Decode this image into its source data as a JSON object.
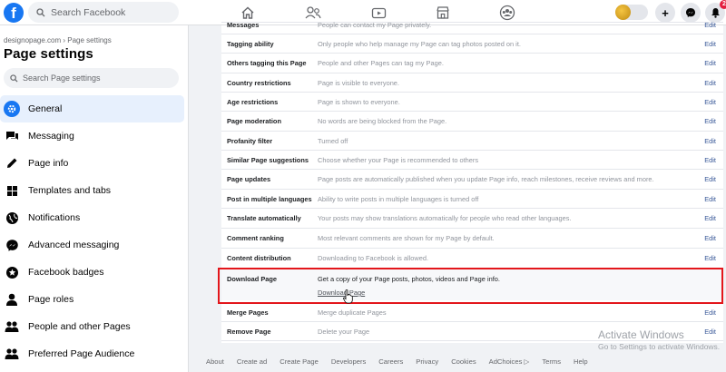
{
  "topbar": {
    "logo": "f",
    "search_placeholder": "Search Facebook",
    "notification_count": "2",
    "icons": [
      "home-icon",
      "friends-icon",
      "watch-icon",
      "marketplace-icon",
      "groups-icon"
    ]
  },
  "sidebar": {
    "breadcrumb": "designopage.com › Page settings",
    "title": "Page settings",
    "search_placeholder": "Search Page settings",
    "items": [
      {
        "label": "General",
        "icon": "gear-icon",
        "active": true
      },
      {
        "label": "Messaging",
        "icon": "chat-icon"
      },
      {
        "label": "Page info",
        "icon": "pencil-icon"
      },
      {
        "label": "Templates and tabs",
        "icon": "grid-icon"
      },
      {
        "label": "Notifications",
        "icon": "globe-icon"
      },
      {
        "label": "Advanced messaging",
        "icon": "messenger-icon"
      },
      {
        "label": "Facebook badges",
        "icon": "badge-icon"
      },
      {
        "label": "Page roles",
        "icon": "person-icon"
      },
      {
        "label": "People and other Pages",
        "icon": "people-icon"
      },
      {
        "label": "Preferred Page Audience",
        "icon": "people-icon"
      }
    ]
  },
  "settings": {
    "edit_label": "Edit",
    "rows": [
      {
        "label": "Messages",
        "desc": "People can contact my Page privately."
      },
      {
        "label": "Tagging ability",
        "desc": "Only people who help manage my Page can tag photos posted on it."
      },
      {
        "label": "Others tagging this Page",
        "desc": "People and other Pages can tag my Page."
      },
      {
        "label": "Country restrictions",
        "desc": "Page is visible to everyone."
      },
      {
        "label": "Age restrictions",
        "desc": "Page is shown to everyone."
      },
      {
        "label": "Page moderation",
        "desc": "No words are being blocked from the Page."
      },
      {
        "label": "Profanity filter",
        "desc": "Turned off"
      },
      {
        "label": "Similar Page suggestions",
        "desc": "Choose whether your Page is recommended to others"
      },
      {
        "label": "Page updates",
        "desc": "Page posts are automatically published when you update Page info, reach milestones, receive reviews and more."
      },
      {
        "label": "Post in multiple languages",
        "desc": "Ability to write posts in multiple languages is turned off"
      },
      {
        "label": "Translate automatically",
        "desc": "Your posts may show translations automatically for people who read other languages."
      },
      {
        "label": "Comment ranking",
        "desc": "Most relevant comments are shown for my Page by default."
      },
      {
        "label": "Content distribution",
        "desc": "Downloading to Facebook is allowed."
      }
    ],
    "download": {
      "label": "Download Page",
      "desc": "Get a copy of your Page posts, photos, videos and Page info.",
      "link": "Download Page"
    },
    "after_rows": [
      {
        "label": "Merge Pages",
        "desc": "Merge duplicate Pages"
      },
      {
        "label": "Remove Page",
        "desc": "Delete your Page"
      }
    ]
  },
  "footer": [
    "About",
    "Create ad",
    "Create Page",
    "Developers",
    "Careers",
    "Privacy",
    "Cookies",
    "AdChoices ▷",
    "Terms",
    "Help"
  ],
  "watermark": {
    "title": "Activate Windows",
    "subtitle": "Go to Settings to activate Windows."
  }
}
